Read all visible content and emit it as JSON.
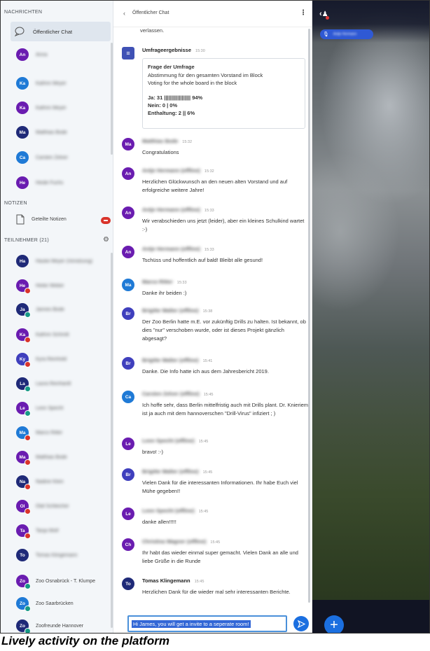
{
  "colors": {
    "accent": "#1b6fe0",
    "avatar_purple": "#6a1cb0",
    "avatar_dark": "#1f2a78",
    "avatar_blue": "#1f7ad6",
    "avatar_indigo": "#3f3fbd",
    "avatar_teal": "#1b8c9e",
    "badge_red": "#d9342b",
    "badge_teal": "#169985"
  },
  "sidebar": {
    "messages_section": "NACHRICHTEN",
    "public_chat_label": "Öffentlicher Chat",
    "chat_users": [
      {
        "initials": "An",
        "name": "Anna",
        "color": "#6a1cb0"
      },
      {
        "initials": "Ka",
        "name": "Kathrin Meyer",
        "color": "#1f7ad6"
      },
      {
        "initials": "Ka",
        "name": "Kathrin Meyer",
        "color": "#6a1cb0"
      },
      {
        "initials": "Ma",
        "name": "Matthias Bode",
        "color": "#1f2a78"
      },
      {
        "initials": "Ca",
        "name": "Carsten Zelver",
        "color": "#1f7ad6"
      },
      {
        "initials": "He",
        "name": "Heide Fuchs",
        "color": "#6a1cb0"
      }
    ],
    "notes_section": "NOTIZEN",
    "shared_notes_label": "Geteilte Notizen",
    "participants_section": "TEILNEHMER (21)",
    "participants": [
      {
        "initials": "Ha",
        "name": "Hauke Meyer (Vorsitzung)",
        "color": "#1f2a78",
        "badge": ""
      },
      {
        "initials": "He",
        "name": "Heike Weber",
        "color": "#6a1cb0",
        "badge": "#d9342b"
      },
      {
        "initials": "Ja",
        "name": "Jannes Bode",
        "color": "#1f2a78",
        "badge": "#169985"
      },
      {
        "initials": "Ka",
        "name": "Kathrin Schmitt",
        "color": "#6a1cb0",
        "badge": "#d9342b"
      },
      {
        "initials": "Ky",
        "name": "Kyra Reinhold",
        "color": "#3f3fbd",
        "badge": "#d9342b"
      },
      {
        "initials": "La",
        "name": "Laura Reinhardt",
        "color": "#1f2a78",
        "badge": "#169985"
      },
      {
        "initials": "Le",
        "name": "Leon Specht",
        "color": "#6a1cb0",
        "badge": "#169985"
      },
      {
        "initials": "Ma",
        "name": "Marco Ritter",
        "color": "#1f7ad6",
        "badge": "#d9342b"
      },
      {
        "initials": "Ma",
        "name": "Matthias Bode",
        "color": "#6a1cb0",
        "badge": "#d9342b"
      },
      {
        "initials": "Na",
        "name": "Nadine Klein",
        "color": "#1f2a78",
        "badge": "#d9342b"
      },
      {
        "initials": "Ol",
        "name": "Olaf Schleicher",
        "color": "#6a1cb0",
        "badge": "#d9342b"
      },
      {
        "initials": "Ta",
        "name": "Tanja Wolf",
        "color": "#6a1cb0",
        "badge": "#d9342b"
      },
      {
        "initials": "To",
        "name": "Tomas Klingemann",
        "color": "#1f2a78",
        "badge": ""
      },
      {
        "initials": "Zo",
        "name": "Zoo Osnabrück - T. Klumpe",
        "color": "#6a1cb0",
        "badge": "#169985"
      },
      {
        "initials": "Zo",
        "name": "Zoo Saarbrücken",
        "color": "#1f7ad6",
        "badge": "#169985"
      },
      {
        "initials": "Zo",
        "name": "Zoofreunde Hannover",
        "color": "#1f2a78",
        "badge": "#169985"
      }
    ]
  },
  "chat": {
    "header_title": "Öffentlicher Chat",
    "clipped_text": "verlassen.",
    "poll": {
      "sender": "Umfrageergebnisse",
      "time": "15:30",
      "heading": "Frage der Umfrage",
      "line1": "Abstimmung für den gesamten Vorstand im Block",
      "line2": "Voting for the whole board in the block",
      "yes": "Ja: 31 |||||||||||||||||| 94%",
      "no": "Nein: 0 | 0%",
      "abstain": "Enthaltung: 2 || 6%"
    },
    "messages": [
      {
        "initials": "Ma",
        "color": "#6a1cb0",
        "name": "Matthias Bode",
        "time": "15:32",
        "text": "Congratulations"
      },
      {
        "initials": "An",
        "color": "#6a1cb0",
        "name": "Antje Hermann (offline)",
        "time": "15:32",
        "text": "Herzlichen Glückwunsch an den neuen alten Vorstand und auf erfolgreiche weitere Jahre!"
      },
      {
        "initials": "An",
        "color": "#6a1cb0",
        "name": "Antje Hermann (offline)",
        "time": "15:33",
        "text": "Wir verabschieden uns jetzt (leider), aber ein kleines Schulkind wartet :-)"
      },
      {
        "initials": "An",
        "color": "#6a1cb0",
        "name": "Antje Hermann (offline)",
        "time": "15:33",
        "text": "Tschüss und hoffentlich auf bald! Bleibt alle gesund!"
      },
      {
        "initials": "Ma",
        "color": "#1f7ad6",
        "name": "Marco Ritter",
        "time": "15:33",
        "text": "Danke ihr beiden :)"
      },
      {
        "initials": "Br",
        "color": "#3f3fbd",
        "name": "Brigitte Walter (offline)",
        "time": "15:38",
        "text": "Der Zoo Berlin hatte m.E. vor zukünftig Drills zu halten. Ist bekannt, ob dies \"nur\" verschoben wurde, oder ist dieses Projekt gänzlich abgesagt?"
      },
      {
        "initials": "Br",
        "color": "#3f3fbd",
        "name": "Brigitte Walter (offline)",
        "time": "15:41",
        "text": "Danke. Die Info hatte ich aus dem Jahresbericht 2019."
      },
      {
        "initials": "Ca",
        "color": "#1f7ad6",
        "name": "Carsten Zelver (offline)",
        "time": "15:45",
        "text": "Ich hoffe sehr, dass Berlin mittelfristig auch mit Drills plant. Dr. Knieriem ist ja auch mit dem hannoverschen \"Drill-Virus\" infiziert ; )"
      },
      {
        "initials": "Le",
        "color": "#6a1cb0",
        "name": "Leon Specht (offline)",
        "time": "15:45",
        "text": "bravo! :-)"
      },
      {
        "initials": "Br",
        "color": "#3f3fbd",
        "name": "Brigitte Walter (offline)",
        "time": "15:45",
        "text": "Vielen Dank für die interessanten Informationen. Ihr habe Euch viel Mühe gegeben!!"
      },
      {
        "initials": "Le",
        "color": "#6a1cb0",
        "name": "Leon Specht (offline)",
        "time": "15:45",
        "text": "danke allen!!!!!"
      },
      {
        "initials": "Ch",
        "color": "#6a1cb0",
        "name": "Christina Wagner (offline)",
        "time": "15:45",
        "text": "Ihr habt das wieder einmal super gemacht. Vielen Dank an alle und liebe Grüße in die Runde"
      },
      {
        "initials": "To",
        "color": "#1f2a78",
        "name": "Tomas Klingemann",
        "time": "15:45",
        "text": "Herzlichen Dank für die wieder mal sehr interessanten Berichte."
      }
    ],
    "composer_text": "Hi James, you will get a invite to a seperate room!"
  },
  "video": {
    "talker_name": "Antje Hermann"
  },
  "caption": "Lively activity on the platform"
}
